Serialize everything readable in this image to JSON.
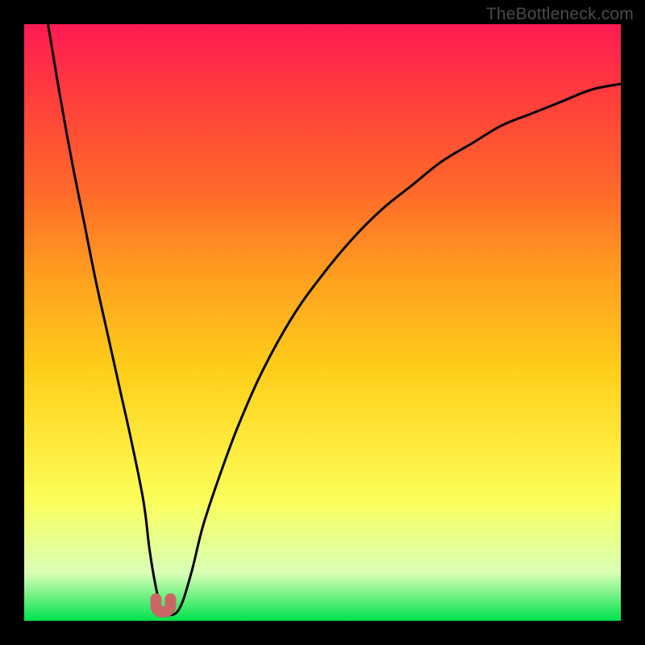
{
  "watermark": "TheBottleneck.com",
  "colors": {
    "frame": "#000000",
    "curve_stroke": "#000000",
    "marker_fill": "#cc6666",
    "gradient_top": "#ff1a54",
    "gradient_bottom": "#00e24d"
  },
  "chart_data": {
    "type": "line",
    "title": "",
    "xlabel": "",
    "ylabel": "",
    "xlim": [
      0,
      100
    ],
    "ylim": [
      0,
      100
    ],
    "gradient_meaning": "vertical gradient red (top, high bottleneck) to green (bottom, low bottleneck)",
    "series": [
      {
        "name": "bottleneck-curve",
        "x": [
          4,
          6,
          8,
          10,
          12,
          14,
          16,
          18,
          20,
          21,
          22,
          23,
          24,
          26,
          28,
          30,
          33,
          36,
          40,
          45,
          50,
          55,
          60,
          65,
          70,
          75,
          80,
          85,
          90,
          95,
          100
        ],
        "values": [
          100,
          88,
          77,
          67,
          57,
          48,
          39,
          30,
          20,
          12,
          6,
          2,
          1,
          2,
          8,
          16,
          25,
          33,
          42,
          51,
          58,
          64,
          69,
          73,
          77,
          80,
          83,
          85,
          87,
          89,
          90
        ]
      }
    ],
    "optimal_marker": {
      "x": 23.3,
      "y": 1.5,
      "shape": "u",
      "color": "#cc6666"
    }
  }
}
